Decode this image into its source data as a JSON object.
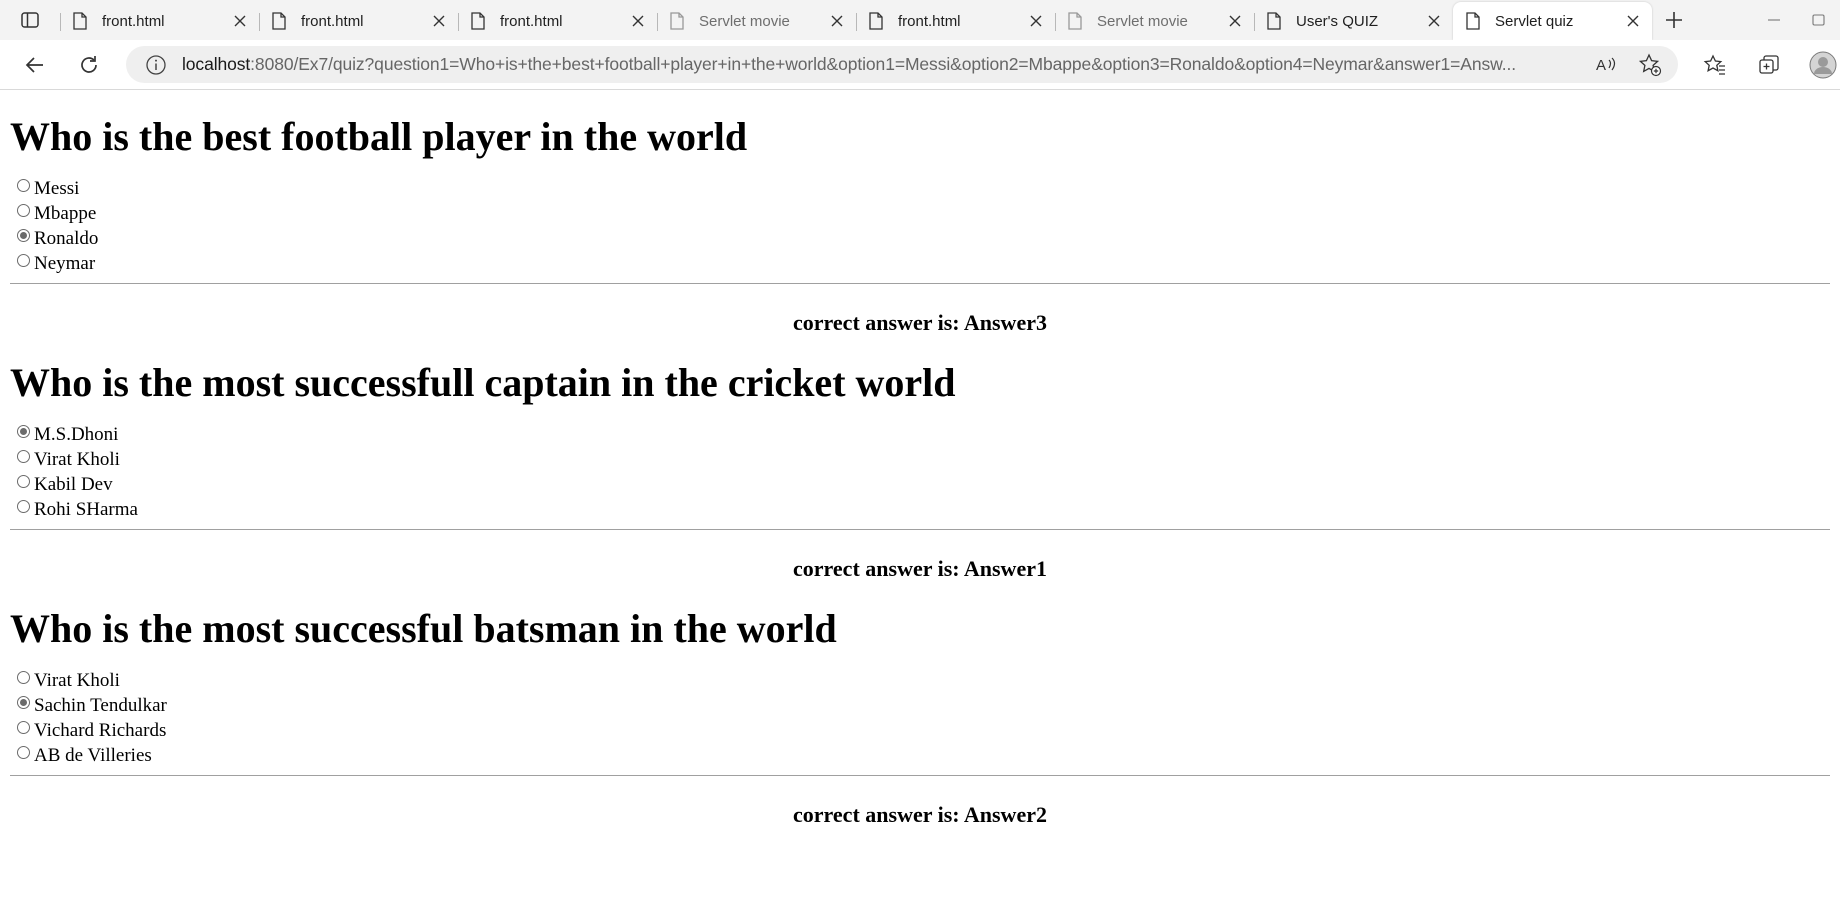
{
  "browser": {
    "tabs": [
      {
        "title": "front.html",
        "dim": false,
        "active": false
      },
      {
        "title": "front.html",
        "dim": false,
        "active": false
      },
      {
        "title": "front.html",
        "dim": false,
        "active": false
      },
      {
        "title": "Servlet movie",
        "dim": true,
        "active": false
      },
      {
        "title": "front.html",
        "dim": false,
        "active": false
      },
      {
        "title": "Servlet movie",
        "dim": true,
        "active": false
      },
      {
        "title": "User's QUIZ",
        "dim": false,
        "active": false
      },
      {
        "title": "Servlet quiz",
        "dim": false,
        "active": true
      }
    ],
    "url_host": "localhost",
    "url_rest": ":8080/Ex7/quiz?question1=Who+is+the+best+football+player+in+the+world&option1=Messi&option2=Mbappe&option3=Ronaldo&option4=Neymar&answer1=Answ..."
  },
  "quiz": [
    {
      "question": "Who is the best football player in the world",
      "options": [
        "Messi",
        "Mbappe",
        "Ronaldo",
        "Neymar"
      ],
      "selected": 2,
      "answer": "correct answer is: Answer3"
    },
    {
      "question": "Who is the most successfull captain in the cricket world",
      "options": [
        "M.S.Dhoni",
        "Virat Kholi",
        "Kabil Dev",
        "Rohi SHarma"
      ],
      "selected": 0,
      "answer": "correct answer is: Answer1"
    },
    {
      "question": "Who is the most successful batsman in the world",
      "options": [
        "Virat Kholi",
        "Sachin Tendulkar",
        "Vichard Richards",
        "AB de Villeries"
      ],
      "selected": 1,
      "answer": "correct answer is: Answer2"
    }
  ]
}
